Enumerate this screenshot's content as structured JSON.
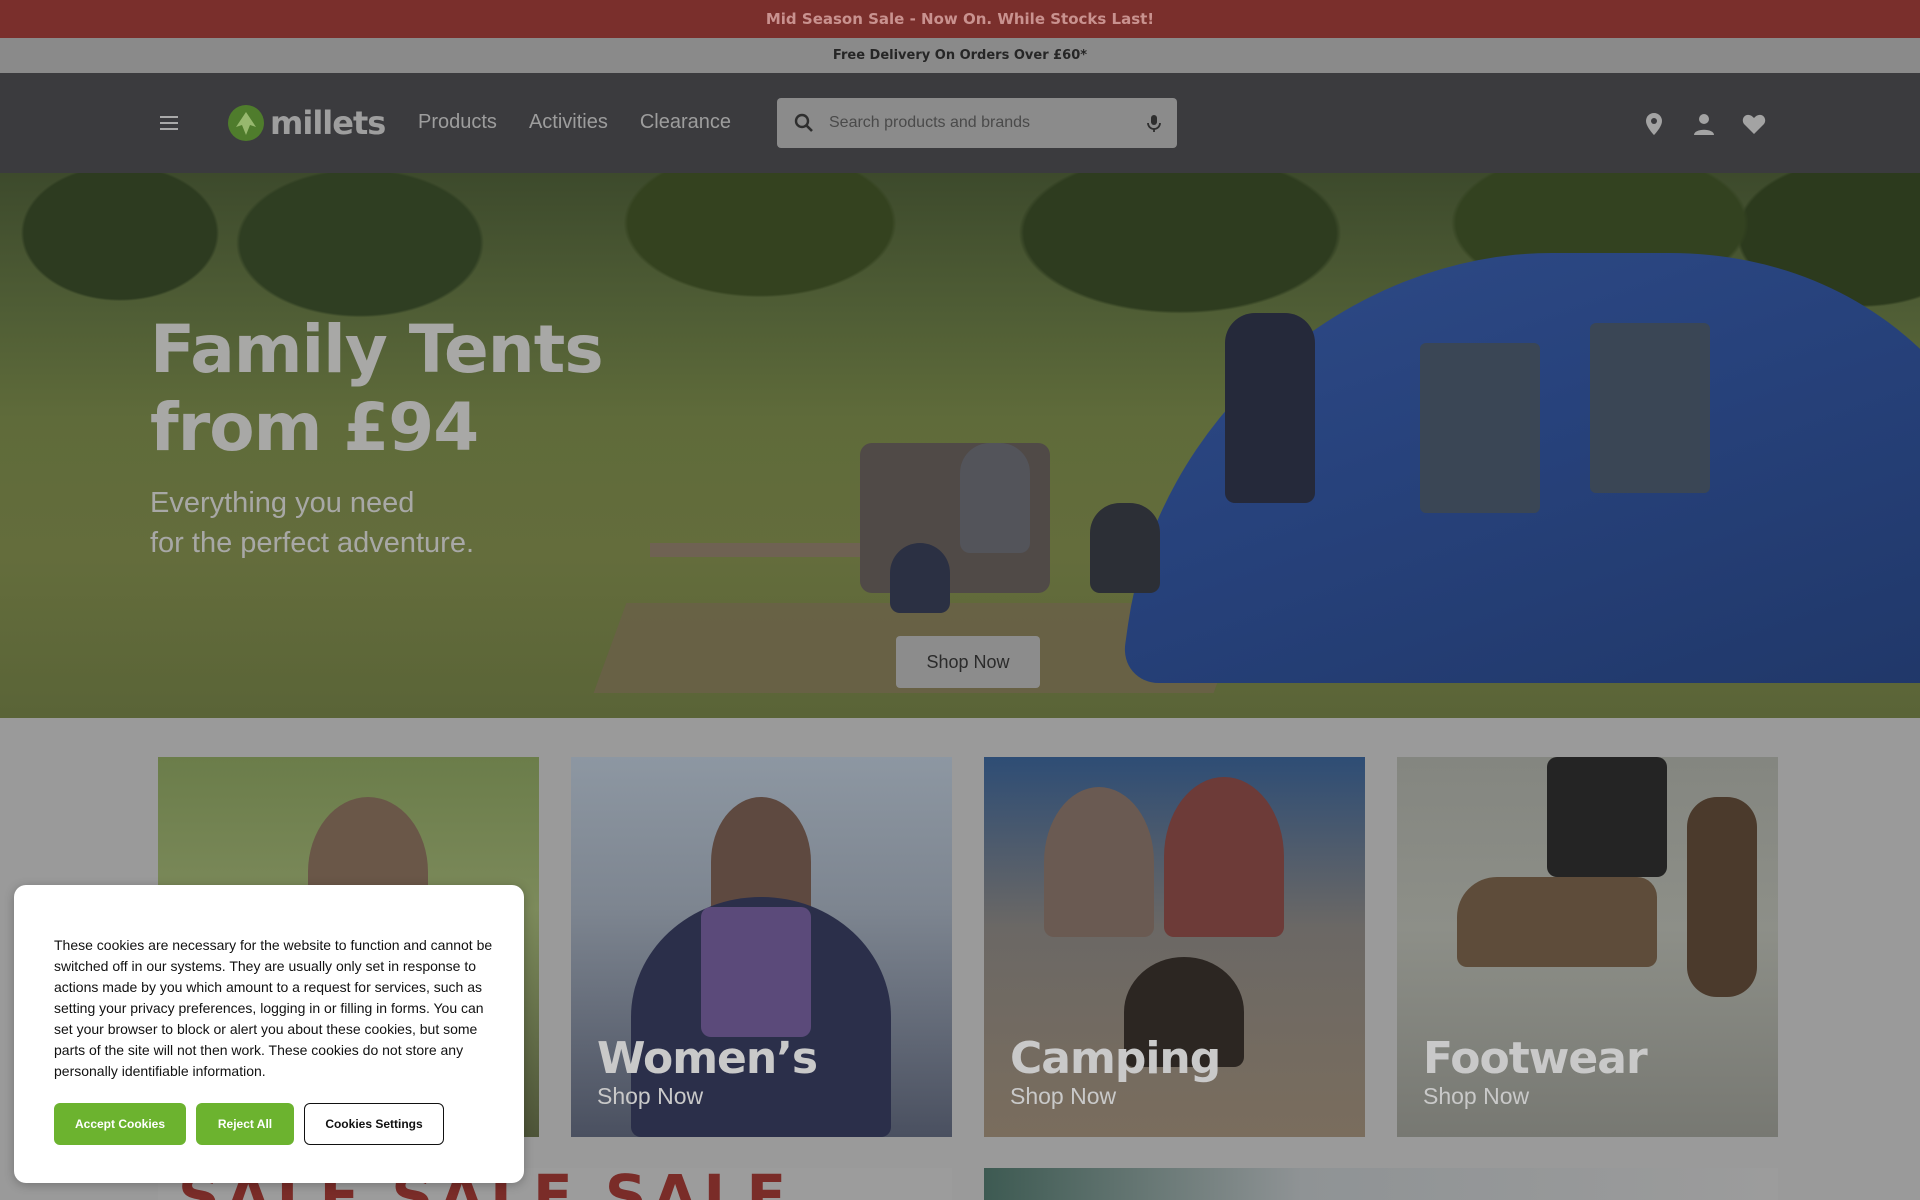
{
  "promo": {
    "top": "Mid Season Sale - Now On. While Stocks Last!",
    "sub": "Free Delivery On Orders Over £60*"
  },
  "header": {
    "logo_text": "millets",
    "nav": [
      "Products",
      "Activities",
      "Clearance"
    ],
    "search_placeholder": "Search products and brands",
    "icons": [
      "store-locator-icon",
      "account-icon",
      "wishlist-heart-icon"
    ]
  },
  "hero": {
    "title_line1": "Family Tents",
    "title_line2": "from £94",
    "sub_line1": "Everything you need",
    "sub_line2": "for the perfect adventure.",
    "cta": "Shop Now"
  },
  "tiles": [
    {
      "title": "",
      "cta": ""
    },
    {
      "title": "Women’s",
      "cta": "Shop Now"
    },
    {
      "title": "Camping",
      "cta": "Shop Now"
    },
    {
      "title": "Footwear",
      "cta": "Shop Now"
    }
  ],
  "lower": {
    "sale_text": "SALE SALE SALE"
  },
  "cookie": {
    "text": "These cookies are necessary for the website to function and cannot be switched off in our systems. They are usually only set in response to actions made by you which amount to a request for services, such as setting your privacy preferences, logging in or filling in forms. You can set your browser to block or alert you about these cookies, but some parts of the site will not then work. These cookies do not store any personally identifiable information.",
    "accept": "Accept Cookies",
    "reject": "Reject All",
    "settings": "Cookies Settings"
  },
  "colors": {
    "promo_bg": "#7a2f2c",
    "header_bg": "#3b3b3e",
    "brand_green": "#6cb32f"
  }
}
